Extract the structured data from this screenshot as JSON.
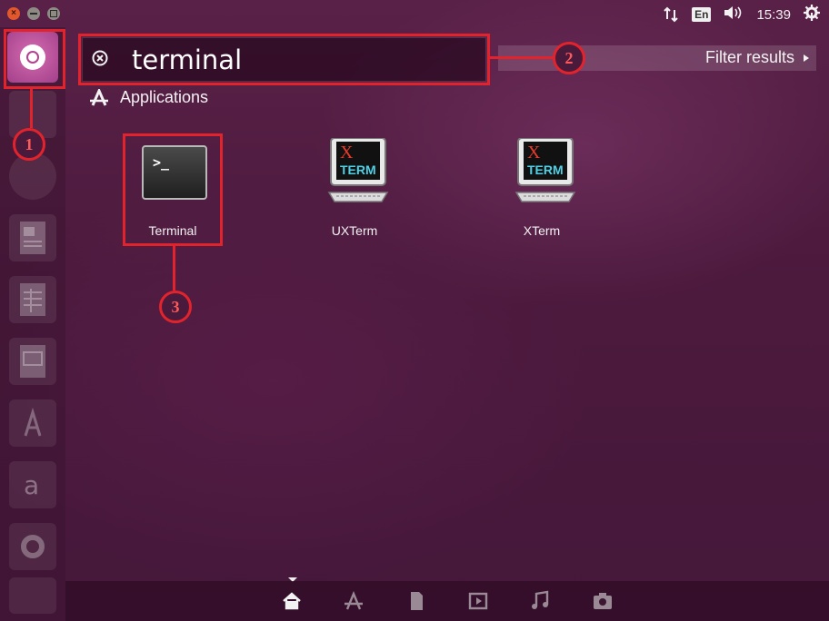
{
  "window_controls": {
    "close": "×"
  },
  "tray": {
    "keyboard_layout": "En",
    "clock": "15:39"
  },
  "search": {
    "query": "terminal",
    "filter_label": "Filter results"
  },
  "category": {
    "label": "Applications"
  },
  "results": [
    {
      "label": "Terminal",
      "icon": "terminal-icon"
    },
    {
      "label": "UXTerm",
      "icon": "xterm-icon"
    },
    {
      "label": "XTerm",
      "icon": "xterm-icon"
    }
  ],
  "xterm_icon_text": {
    "x": "X",
    "term": "TERM"
  },
  "terminal_prompt": ">_",
  "callouts": [
    "1",
    "2",
    "3"
  ],
  "lenses": [
    "home-lens",
    "applications-lens",
    "files-lens",
    "video-lens",
    "music-lens",
    "photos-lens"
  ],
  "colors": {
    "background": "#4a1a3c",
    "highlight": "#e3232c",
    "dash_button": "#c05aa2",
    "window_close": "#e2572b"
  }
}
